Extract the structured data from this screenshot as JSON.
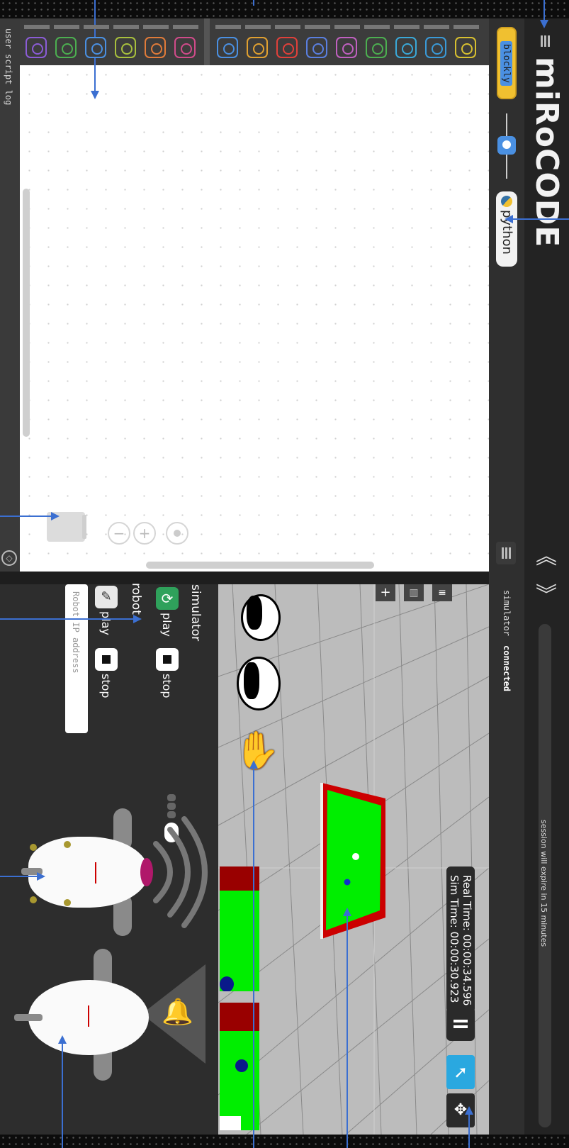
{
  "app": {
    "title": "miRoCODE",
    "session_notice": "session will expire in 15 minutes"
  },
  "mode": {
    "blockly_label": "blockly",
    "python_label": "python"
  },
  "log": {
    "label": "user script log"
  },
  "simulator": {
    "status_prefix": "simulator",
    "status_value": "connected",
    "real_time": "Real Time: 00:00:34.596",
    "sim_time": "Sim Time: 00:00:30.923"
  },
  "controls": {
    "simulator_heading": "simulator",
    "robot_heading": "robot",
    "play_label": "play",
    "stop_label": "stop",
    "robot_play_label": "play",
    "robot_stop_label": "stop",
    "ip_placeholder": "Robot IP address"
  },
  "colors": {
    "accent": "#3b6fd1",
    "green_play": "#2fa15b",
    "arena_green": "#00ee00",
    "arena_border": "#cc0000",
    "sim_blue": "#2aa8e0"
  },
  "categories_left": [
    {
      "icon": "route-icon",
      "color": "#8b5cd6"
    },
    {
      "icon": "gauge-icon",
      "color": "#4caf50"
    },
    {
      "icon": "lights-icon",
      "color": "#4a90e2"
    },
    {
      "icon": "math-icon",
      "color": "#a8c03d"
    },
    {
      "icon": "loop-icon",
      "color": "#e07b39"
    },
    {
      "icon": "brain-icon",
      "color": "#d04b8a"
    }
  ],
  "categories_right": [
    {
      "icon": "speedometer-icon",
      "color": "#4a90e2"
    },
    {
      "icon": "bell-icon",
      "color": "#e0a030"
    },
    {
      "icon": "eye-icon",
      "color": "#e0403a"
    },
    {
      "icon": "person-icon",
      "color": "#5a7fe0"
    },
    {
      "icon": "wave-icon",
      "color": "#c060c0"
    },
    {
      "icon": "joystick-icon",
      "color": "#4caf50"
    },
    {
      "icon": "rotate-icon",
      "color": "#3aa8d8"
    },
    {
      "icon": "move-icon",
      "color": "#3a9ad8"
    },
    {
      "icon": "key-icon",
      "color": "#d8c030"
    }
  ]
}
